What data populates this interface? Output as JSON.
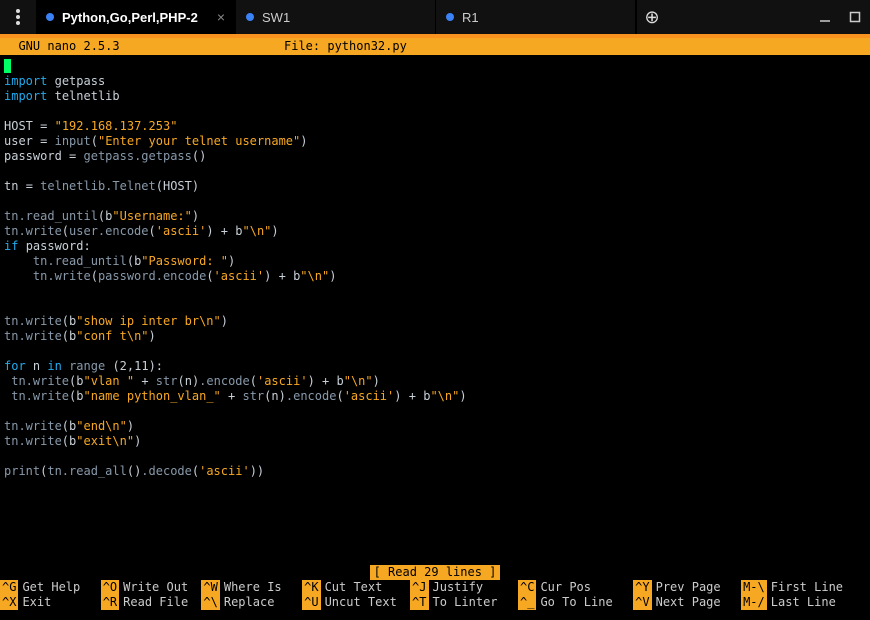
{
  "window": {
    "tabs": [
      {
        "label": "Python,Go,Perl,PHP-2",
        "active": true,
        "closeable": true
      },
      {
        "label": "SW1",
        "active": false,
        "closeable": false
      },
      {
        "label": "R1",
        "active": false,
        "closeable": false
      }
    ],
    "newTabGlyph": "⊕"
  },
  "nano": {
    "version": "GNU nano 2.5.3",
    "fileLabel": "File: python32.py",
    "status": "[ Read 29 lines ]",
    "shortcuts": [
      [
        {
          "key": "^G",
          "label": "Get Help"
        },
        {
          "key": "^O",
          "label": "Write Out"
        },
        {
          "key": "^W",
          "label": "Where Is"
        },
        {
          "key": "^K",
          "label": "Cut Text"
        },
        {
          "key": "^J",
          "label": "Justify"
        },
        {
          "key": "^C",
          "label": "Cur Pos"
        },
        {
          "key": "^Y",
          "label": "Prev Page"
        },
        {
          "key": "M-\\",
          "label": "First Line"
        }
      ],
      [
        {
          "key": "^X",
          "label": "Exit"
        },
        {
          "key": "^R",
          "label": "Read File"
        },
        {
          "key": "^\\",
          "label": "Replace"
        },
        {
          "key": "^U",
          "label": "Uncut Text"
        },
        {
          "key": "^T",
          "label": "To Linter"
        },
        {
          "key": "^_",
          "label": "Go To Line"
        },
        {
          "key": "^V",
          "label": "Next Page"
        },
        {
          "key": "M-/",
          "label": "Last Line"
        }
      ]
    ]
  },
  "code": {
    "lines": [
      [
        {
          "t": "cursor"
        }
      ],
      [
        {
          "t": "kw",
          "v": "import"
        },
        {
          "t": "sp"
        },
        {
          "t": "id",
          "v": "getpass"
        }
      ],
      [
        {
          "t": "kw",
          "v": "import"
        },
        {
          "t": "sp"
        },
        {
          "t": "id",
          "v": "telnetlib"
        }
      ],
      [],
      [
        {
          "t": "id",
          "v": "HOST"
        },
        {
          "t": "sp"
        },
        {
          "t": "eq",
          "v": "="
        },
        {
          "t": "sp"
        },
        {
          "t": "str",
          "v": "\"192.168.137.253\""
        }
      ],
      [
        {
          "t": "id",
          "v": "user"
        },
        {
          "t": "sp"
        },
        {
          "t": "eq",
          "v": "="
        },
        {
          "t": "sp"
        },
        {
          "t": "fn",
          "v": "input"
        },
        {
          "t": "paren",
          "v": "("
        },
        {
          "t": "str",
          "v": "\"Enter your telnet username\""
        },
        {
          "t": "paren",
          "v": ")"
        }
      ],
      [
        {
          "t": "id",
          "v": "password"
        },
        {
          "t": "sp"
        },
        {
          "t": "eq",
          "v": "="
        },
        {
          "t": "sp"
        },
        {
          "t": "fn",
          "v": "getpass.getpass"
        },
        {
          "t": "paren",
          "v": "()"
        }
      ],
      [],
      [
        {
          "t": "id",
          "v": "tn"
        },
        {
          "t": "sp"
        },
        {
          "t": "eq",
          "v": "="
        },
        {
          "t": "sp"
        },
        {
          "t": "fn",
          "v": "telnetlib.Telnet"
        },
        {
          "t": "paren",
          "v": "("
        },
        {
          "t": "id",
          "v": "HOST"
        },
        {
          "t": "paren",
          "v": ")"
        }
      ],
      [],
      [
        {
          "t": "fn",
          "v": "tn.read_until"
        },
        {
          "t": "paren",
          "v": "("
        },
        {
          "t": "id",
          "v": "b"
        },
        {
          "t": "str",
          "v": "\"Username:\""
        },
        {
          "t": "paren",
          "v": ")"
        }
      ],
      [
        {
          "t": "fn",
          "v": "tn.write"
        },
        {
          "t": "paren",
          "v": "("
        },
        {
          "t": "fn",
          "v": "user.encode"
        },
        {
          "t": "paren",
          "v": "("
        },
        {
          "t": "str",
          "v": "'ascii'"
        },
        {
          "t": "paren",
          "v": ")"
        },
        {
          "t": "sp"
        },
        {
          "t": "eq",
          "v": "+"
        },
        {
          "t": "sp"
        },
        {
          "t": "id",
          "v": "b"
        },
        {
          "t": "str",
          "v": "\"\\n\""
        },
        {
          "t": "paren",
          "v": ")"
        }
      ],
      [
        {
          "t": "kw",
          "v": "if"
        },
        {
          "t": "sp"
        },
        {
          "t": "id",
          "v": "password"
        },
        {
          "t": "paren",
          "v": ":"
        }
      ],
      [
        {
          "t": "sp4"
        },
        {
          "t": "fn",
          "v": "tn.read_until"
        },
        {
          "t": "paren",
          "v": "("
        },
        {
          "t": "id",
          "v": "b"
        },
        {
          "t": "str",
          "v": "\"Password: \""
        },
        {
          "t": "paren",
          "v": ")"
        }
      ],
      [
        {
          "t": "sp4"
        },
        {
          "t": "fn",
          "v": "tn.write"
        },
        {
          "t": "paren",
          "v": "("
        },
        {
          "t": "fn",
          "v": "password.encode"
        },
        {
          "t": "paren",
          "v": "("
        },
        {
          "t": "str",
          "v": "'ascii'"
        },
        {
          "t": "paren",
          "v": ")"
        },
        {
          "t": "sp"
        },
        {
          "t": "eq",
          "v": "+"
        },
        {
          "t": "sp"
        },
        {
          "t": "id",
          "v": "b"
        },
        {
          "t": "str",
          "v": "\"\\n\""
        },
        {
          "t": "paren",
          "v": ")"
        }
      ],
      [],
      [],
      [
        {
          "t": "fn",
          "v": "tn.write"
        },
        {
          "t": "paren",
          "v": "("
        },
        {
          "t": "id",
          "v": "b"
        },
        {
          "t": "str",
          "v": "\"show ip inter br\\n\""
        },
        {
          "t": "paren",
          "v": ")"
        }
      ],
      [
        {
          "t": "fn",
          "v": "tn.write"
        },
        {
          "t": "paren",
          "v": "("
        },
        {
          "t": "id",
          "v": "b"
        },
        {
          "t": "str",
          "v": "\"conf t\\n\""
        },
        {
          "t": "paren",
          "v": ")"
        }
      ],
      [],
      [
        {
          "t": "kw",
          "v": "for"
        },
        {
          "t": "sp"
        },
        {
          "t": "id",
          "v": "n"
        },
        {
          "t": "sp"
        },
        {
          "t": "kw",
          "v": "in"
        },
        {
          "t": "sp"
        },
        {
          "t": "fn",
          "v": "range"
        },
        {
          "t": "sp"
        },
        {
          "t": "paren",
          "v": "("
        },
        {
          "t": "id",
          "v": "2,11"
        },
        {
          "t": "paren",
          "v": "):"
        }
      ],
      [
        {
          "t": "sp1"
        },
        {
          "t": "fn",
          "v": "tn.write"
        },
        {
          "t": "paren",
          "v": "("
        },
        {
          "t": "id",
          "v": "b"
        },
        {
          "t": "str",
          "v": "\"vlan \""
        },
        {
          "t": "sp"
        },
        {
          "t": "eq",
          "v": "+"
        },
        {
          "t": "sp"
        },
        {
          "t": "fn",
          "v": "str"
        },
        {
          "t": "paren",
          "v": "("
        },
        {
          "t": "id",
          "v": "n"
        },
        {
          "t": "paren",
          "v": ")"
        },
        {
          "t": "fn",
          "v": ".encode"
        },
        {
          "t": "paren",
          "v": "("
        },
        {
          "t": "str",
          "v": "'ascii'"
        },
        {
          "t": "paren",
          "v": ")"
        },
        {
          "t": "sp"
        },
        {
          "t": "eq",
          "v": "+"
        },
        {
          "t": "sp"
        },
        {
          "t": "id",
          "v": "b"
        },
        {
          "t": "str",
          "v": "\"\\n\""
        },
        {
          "t": "paren",
          "v": ")"
        }
      ],
      [
        {
          "t": "sp1"
        },
        {
          "t": "fn",
          "v": "tn.write"
        },
        {
          "t": "paren",
          "v": "("
        },
        {
          "t": "id",
          "v": "b"
        },
        {
          "t": "str",
          "v": "\"name python_vlan_\""
        },
        {
          "t": "sp"
        },
        {
          "t": "eq",
          "v": "+"
        },
        {
          "t": "sp"
        },
        {
          "t": "fn",
          "v": "str"
        },
        {
          "t": "paren",
          "v": "("
        },
        {
          "t": "id",
          "v": "n"
        },
        {
          "t": "paren",
          "v": ")"
        },
        {
          "t": "fn",
          "v": ".encode"
        },
        {
          "t": "paren",
          "v": "("
        },
        {
          "t": "str",
          "v": "'ascii'"
        },
        {
          "t": "paren",
          "v": ")"
        },
        {
          "t": "sp"
        },
        {
          "t": "eq",
          "v": "+"
        },
        {
          "t": "sp"
        },
        {
          "t": "id",
          "v": "b"
        },
        {
          "t": "str",
          "v": "\"\\n\""
        },
        {
          "t": "paren",
          "v": ")"
        }
      ],
      [],
      [
        {
          "t": "fn",
          "v": "tn.write"
        },
        {
          "t": "paren",
          "v": "("
        },
        {
          "t": "id",
          "v": "b"
        },
        {
          "t": "str",
          "v": "\"end\\n\""
        },
        {
          "t": "paren",
          "v": ")"
        }
      ],
      [
        {
          "t": "fn",
          "v": "tn.write"
        },
        {
          "t": "paren",
          "v": "("
        },
        {
          "t": "id",
          "v": "b"
        },
        {
          "t": "str",
          "v": "\"exit\\n\""
        },
        {
          "t": "paren",
          "v": ")"
        }
      ],
      [],
      [
        {
          "t": "fn",
          "v": "print"
        },
        {
          "t": "paren",
          "v": "("
        },
        {
          "t": "fn",
          "v": "tn.read_all"
        },
        {
          "t": "paren",
          "v": "()"
        },
        {
          "t": "fn",
          "v": ".decode"
        },
        {
          "t": "paren",
          "v": "("
        },
        {
          "t": "str",
          "v": "'ascii'"
        },
        {
          "t": "paren",
          "v": "))"
        }
      ]
    ]
  }
}
